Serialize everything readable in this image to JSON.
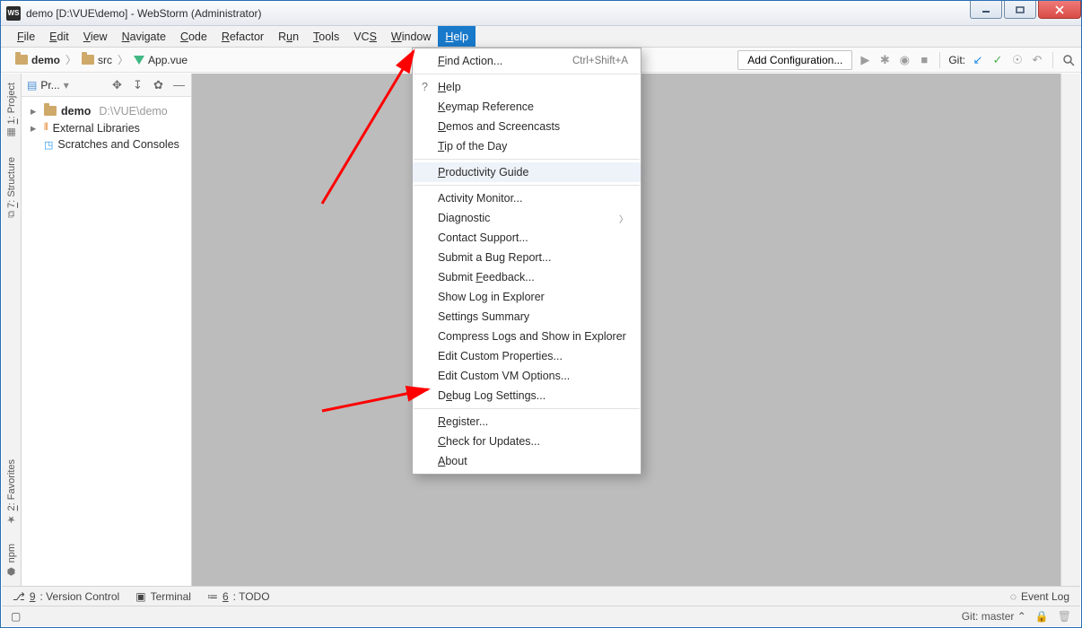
{
  "window": {
    "app_icon_text": "WS",
    "title": "demo [D:\\VUE\\demo] - WebStorm (Administrator)"
  },
  "menubar": {
    "file": "File",
    "edit": "Edit",
    "view": "View",
    "navigate": "Navigate",
    "code": "Code",
    "refactor": "Refactor",
    "run": "Run",
    "tools": "Tools",
    "vcs": "VCS",
    "window": "Window",
    "help": "Help"
  },
  "breadcrumb": {
    "root": "demo",
    "src": "src",
    "file": "App.vue"
  },
  "toolbar_right": {
    "add_configuration": "Add Configuration...",
    "git_label": "Git:"
  },
  "project_panel": {
    "title": "Pr...",
    "tree": {
      "root": "demo",
      "root_path": "D:\\VUE\\demo",
      "external_libraries": "External Libraries",
      "scratches": "Scratches and Consoles"
    }
  },
  "left_rail": {
    "project_num": "1",
    "project": ": Project",
    "structure_num": "7",
    "structure": ": Structure",
    "favorites_num": "2",
    "favorites": ": Favorites",
    "npm": "npm"
  },
  "help_menu": {
    "find_action": "Find Action...",
    "find_action_shortcut": "Ctrl+Shift+A",
    "help": "Help",
    "keymap_reference": "Keymap Reference",
    "demos": "Demos and Screencasts",
    "tip_of_day": "Tip of the Day",
    "productivity_guide": "Productivity Guide",
    "activity_monitor": "Activity Monitor...",
    "diagnostic": "Diagnostic",
    "contact_support": "Contact Support...",
    "submit_bug": "Submit a Bug Report...",
    "submit_feedback": "Submit Feedback...",
    "show_log": "Show Log in Explorer",
    "settings_summary": "Settings Summary",
    "compress_logs": "Compress Logs and Show in Explorer",
    "edit_custom_props": "Edit Custom Properties...",
    "edit_custom_vm": "Edit Custom VM Options...",
    "debug_log": "Debug Log Settings...",
    "register": "Register...",
    "check_updates": "Check for Updates...",
    "about": "About"
  },
  "bottom_strip": {
    "version_control_num": "9",
    "version_control": ": Version Control",
    "terminal": "Terminal",
    "todo_num": "6",
    "todo": ": TODO",
    "event_log": "Event Log"
  },
  "statusbar": {
    "git_label": "Git:",
    "git_branch": "master"
  }
}
